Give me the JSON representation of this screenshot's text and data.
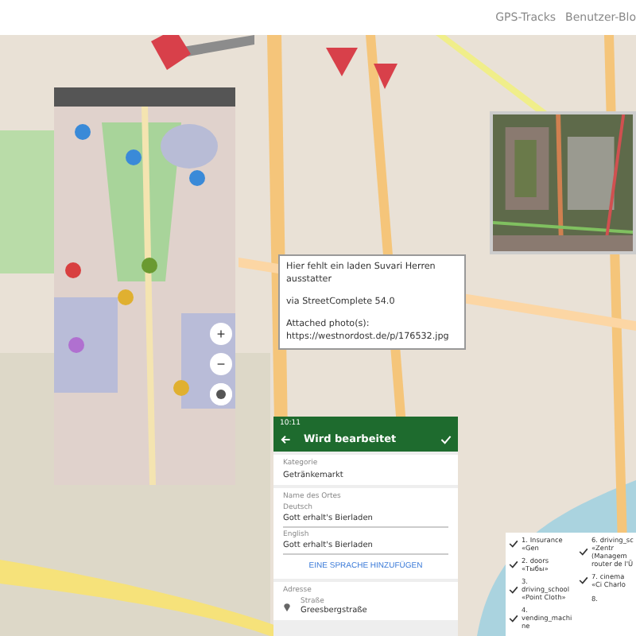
{
  "nav": {
    "links": [
      "GPS-Tracks",
      "Benutzer-Blo"
    ]
  },
  "note_popup": {
    "lines": [
      "Hier fehlt ein laden Suvari Herren ausstatter",
      "via StreetComplete 54.0",
      "Attached photo(s):",
      "https://westnordost.de/p/176532.jpg"
    ]
  },
  "map_controls": [
    "+",
    "−"
  ],
  "edit_screen": {
    "status_time": "10:11",
    "title": "Wird bearbeitet",
    "category_label": "Kategorie",
    "category_value": "Getränkemarkt",
    "name_section": "Name des Ortes",
    "names": [
      {
        "language": "Deutsch",
        "value": "Gott erhalt's Bierladen"
      },
      {
        "language": "English",
        "value": "Gott erhalt's Bierladen"
      }
    ],
    "add_language": "EINE SPRACHE HINZUFÜGEN",
    "address_section": "Adresse",
    "street_label": "Straße",
    "street_value": "Greesbergstraße"
  },
  "task_list": {
    "columns": [
      {
        "items": [
          {
            "text": "1. Insurance «Gen",
            "checked": true
          },
          {
            "text": "2. doors «Тыбы»",
            "checked": true
          },
          {
            "text": "3. driving_school «Point Cloth»",
            "checked": true
          },
          {
            "text": "4. vending_machine",
            "checked": true
          }
        ]
      },
      {
        "items": [
          {
            "text": "6. driving_sc «Zentr (Managem router de l'Ü",
            "checked": true
          },
          {
            "text": "7. cinema «Ci Charlo",
            "checked": true
          },
          {
            "text": "8.",
            "checked": false
          }
        ]
      }
    ]
  }
}
